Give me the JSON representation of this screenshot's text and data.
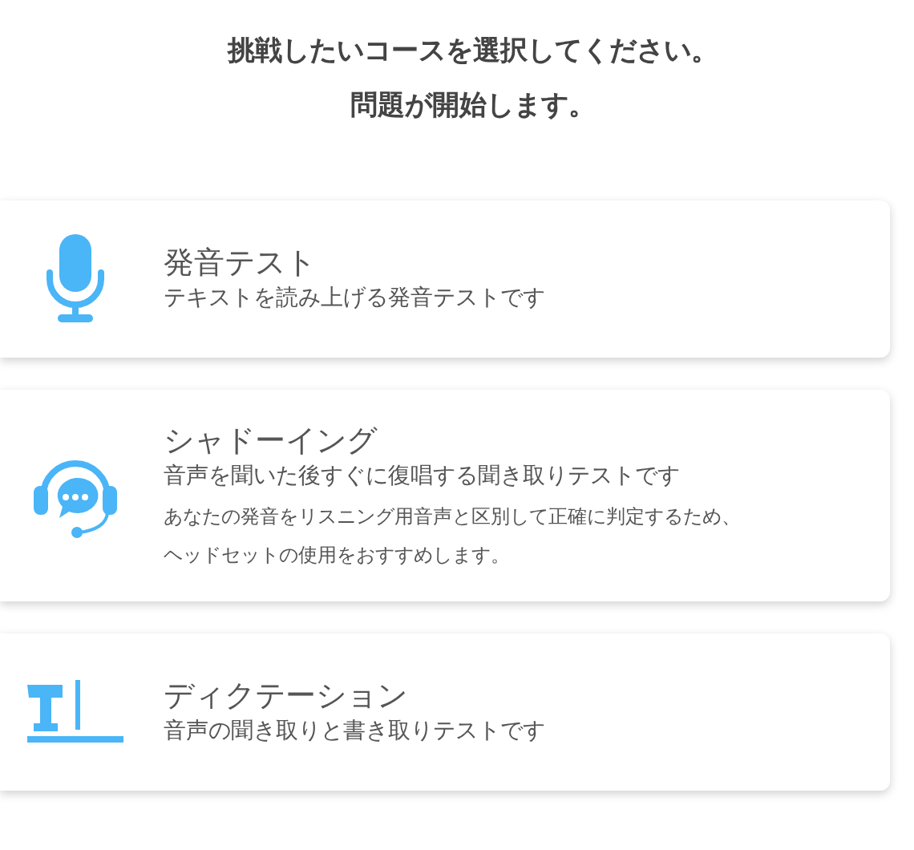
{
  "heading": [
    "挑戦したいコースを選択してください。",
    "問題が開始します。"
  ],
  "courses": [
    {
      "kind": "microphone",
      "title": "発音テスト",
      "description": "テキストを読み上げる発音テストです"
    },
    {
      "kind": "headset",
      "title": "シャドーイング",
      "description": "音声を聞いた後すぐに復唱する聞き取りテストです",
      "notes": [
        "あなたの発音をリスニング用音声と区別して正確に判定するため、",
        "ヘッドセットの使用をおすすめします。"
      ]
    },
    {
      "kind": "text",
      "title": "ディクテーション",
      "description": "音声の聞き取りと書き取りテストです"
    }
  ]
}
